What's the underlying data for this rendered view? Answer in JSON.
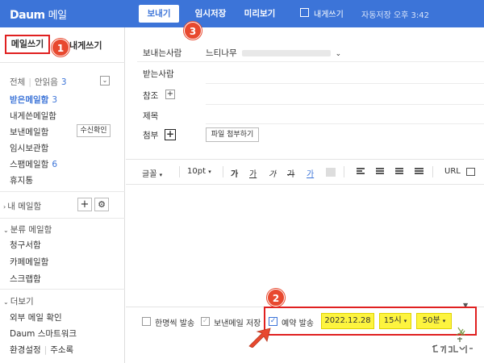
{
  "topbar": {
    "logo": "Daum",
    "logo_sub": "메일",
    "send": "보내기",
    "draft": "임시저장",
    "preview": "미리보기",
    "self_mail": "내게쓰기",
    "autosave": "자동저장 오후 3:42"
  },
  "sidebar": {
    "write": "메일쓰기",
    "self_write": "내게쓰기",
    "all": "전체",
    "unread_label": "안읽음",
    "unread_count": "3",
    "items": [
      {
        "label": "받은메일함",
        "count": "3"
      },
      {
        "label": "내게쓴메일함",
        "count": ""
      },
      {
        "label": "보낸메일함",
        "count": ""
      },
      {
        "label": "임시보관함",
        "count": ""
      },
      {
        "label": "스팸메일함",
        "count": "6"
      },
      {
        "label": "휴지통",
        "count": ""
      }
    ],
    "receipt_btn": "수신확인",
    "my_folders": "내 메일함",
    "category_folders": "분류 메일함",
    "category_items": [
      "청구서함",
      "카페메일함",
      "스크랩함"
    ],
    "more": "더보기",
    "more_items": [
      "외부 메일 확인",
      "Daum 스마트워크"
    ],
    "settings": "환경설정",
    "address_book": "주소록"
  },
  "compose": {
    "sender_label": "보내는사람",
    "sender_value": "느티나무",
    "to_label": "받는사람",
    "cc_label": "참조",
    "subject_label": "제목",
    "attach_label": "첨부",
    "attach_btn": "파일 첨부하기"
  },
  "toolbar": {
    "font": "글꼴",
    "size": "10pt",
    "bold": "가",
    "underline": "가",
    "italic": "가",
    "strike": "가",
    "color": "가",
    "url": "URL"
  },
  "bottom": {
    "individual_send": "한명씩 발송",
    "save_sent": "보낸메일 저장",
    "reserve": "예약 발송",
    "date": "2022.12.28",
    "hour": "15시",
    "minute": "50분"
  },
  "annotations": {
    "step1": "1",
    "step2": "2",
    "step3": "3"
  },
  "colors": {
    "brand": "#3c74d8",
    "highlight": "#fdf43f",
    "annotation": "#e8492f"
  }
}
